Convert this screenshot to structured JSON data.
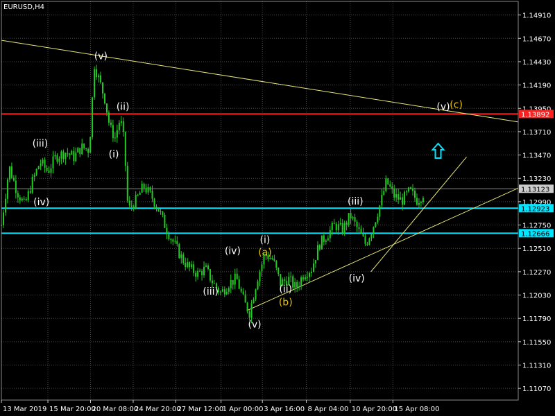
{
  "chart_data": {
    "type": "candlestick",
    "title": "EURUSD,H4",
    "colors": {
      "background": "#000000",
      "grid": "#4a4a4a",
      "candle": "#22cc22",
      "trendline": "#e8e87a",
      "resistance": "#ff2020",
      "support": "#00e5ff",
      "current_price": "#8a8a8a",
      "wave_white": "#ffffff",
      "wave_yellow": "#e8c400",
      "arrow": "#00e5ff"
    },
    "y_range": [
      1.1095,
      1.1505
    ],
    "y_ticks": [
      "1.14910",
      "1.14670",
      "1.14430",
      "1.14190",
      "1.13950",
      "1.13710",
      "1.13470",
      "1.13230",
      "1.12990",
      "1.12750",
      "1.12510",
      "1.12270",
      "1.12030",
      "1.11790",
      "1.11550",
      "1.11310",
      "1.11070"
    ],
    "x_range": [
      0,
      200
    ],
    "x_ticks": [
      {
        "label": "13 Mar 2019",
        "x": 0
      },
      {
        "label": "15 Mar 20:00",
        "x": 18
      },
      {
        "label": "20 Mar 08:00",
        "x": 34.5
      },
      {
        "label": "24 Mar 20:00",
        "x": 51
      },
      {
        "label": "27 Mar 12:00",
        "x": 67.5
      },
      {
        "label": "1 Apr 00:00",
        "x": 85
      },
      {
        "label": "3 Apr 16:00",
        "x": 101
      },
      {
        "label": "8 Apr 04:00",
        "x": 118
      },
      {
        "label": "10 Apr 20:00",
        "x": 135
      },
      {
        "label": "15 Apr 08:00",
        "x": 151.5
      }
    ],
    "horizontal_levels": [
      {
        "name": "resistance",
        "price": 1.13892,
        "label": "1.13892"
      },
      {
        "name": "current",
        "price": 1.13123,
        "label": "1.13123"
      },
      {
        "name": "support-1",
        "price": 1.12923,
        "label": "1.12923"
      },
      {
        "name": "support-2",
        "price": 1.12666,
        "label": "1.12666"
      }
    ],
    "trendlines": [
      {
        "from": [
          0,
          1.1465
        ],
        "to": [
          200,
          1.1381
        ]
      },
      {
        "from": [
          95,
          1.1187
        ],
        "to": [
          200,
          1.1313
        ]
      },
      {
        "from": [
          143,
          1.1227
        ],
        "to": [
          180,
          1.1345
        ]
      }
    ],
    "path_points": [
      [
        0,
        1.1275
      ],
      [
        3,
        1.1335
      ],
      [
        6,
        1.131
      ],
      [
        9,
        1.1295
      ],
      [
        12,
        1.132
      ],
      [
        15,
        1.134
      ],
      [
        18,
        1.133
      ],
      [
        21,
        1.1345
      ],
      [
        25,
        1.135
      ],
      [
        28,
        1.1345
      ],
      [
        31,
        1.1355
      ],
      [
        34,
        1.1352
      ],
      [
        36,
        1.144
      ],
      [
        40,
        1.1405
      ],
      [
        42,
        1.1375
      ],
      [
        44,
        1.1365
      ],
      [
        46,
        1.1385
      ],
      [
        47.5,
        1.136
      ],
      [
        49,
        1.129
      ],
      [
        52,
        1.13
      ],
      [
        55,
        1.1315
      ],
      [
        58,
        1.1305
      ],
      [
        61,
        1.129
      ],
      [
        64,
        1.127
      ],
      [
        67,
        1.1255
      ],
      [
        70,
        1.124
      ],
      [
        73,
        1.123
      ],
      [
        76,
        1.1225
      ],
      [
        79,
        1.123
      ],
      [
        82,
        1.1215
      ],
      [
        85,
        1.1205
      ],
      [
        88,
        1.1215
      ],
      [
        91,
        1.122
      ],
      [
        94,
        1.1195
      ],
      [
        96,
        1.1185
      ],
      [
        99,
        1.122
      ],
      [
        102,
        1.1245
      ],
      [
        105,
        1.124
      ],
      [
        108,
        1.1215
      ],
      [
        111,
        1.122
      ],
      [
        114,
        1.121
      ],
      [
        117,
        1.1225
      ],
      [
        120,
        1.123
      ],
      [
        123,
        1.1255
      ],
      [
        126,
        1.1265
      ],
      [
        129,
        1.1275
      ],
      [
        132,
        1.127
      ],
      [
        135,
        1.1285
      ],
      [
        138,
        1.127
      ],
      [
        141,
        1.1255
      ],
      [
        144,
        1.1275
      ],
      [
        147,
        1.13
      ],
      [
        149,
        1.132
      ],
      [
        152,
        1.1305
      ],
      [
        155,
        1.13
      ],
      [
        158,
        1.131
      ],
      [
        161,
        1.13
      ],
      [
        164,
        1.131
      ]
    ],
    "wave_labels": [
      {
        "text": "(v)",
        "x": 38.5,
        "y": 1.14455,
        "color": "white"
      },
      {
        "text": "(ii)",
        "x": 47,
        "y": 1.13935,
        "color": "white"
      },
      {
        "text": "(iii)",
        "x": 15,
        "y": 1.13555,
        "color": "white"
      },
      {
        "text": "(i)",
        "x": 43.5,
        "y": 1.13445,
        "color": "white"
      },
      {
        "text": "(iv)",
        "x": 15.5,
        "y": 1.12955,
        "color": "white"
      },
      {
        "text": "(iv)",
        "x": 89.5,
        "y": 1.1245,
        "color": "white"
      },
      {
        "text": "(i)",
        "x": 102,
        "y": 1.12565,
        "color": "white"
      },
      {
        "text": "(a)",
        "x": 102,
        "y": 1.12435,
        "color": "yellow"
      },
      {
        "text": "(iii)",
        "x": 81,
        "y": 1.12035,
        "color": "white"
      },
      {
        "text": "(ii)",
        "x": 110,
        "y": 1.1206,
        "color": "white"
      },
      {
        "text": "(b)",
        "x": 110,
        "y": 1.11925,
        "color": "yellow"
      },
      {
        "text": "(v)",
        "x": 98,
        "y": 1.11695,
        "color": "white"
      },
      {
        "text": "(iii)",
        "x": 137,
        "y": 1.1296,
        "color": "white"
      },
      {
        "text": "(iv)",
        "x": 137.5,
        "y": 1.1217,
        "color": "white"
      },
      {
        "text": "(v)",
        "x": 171,
        "y": 1.13935,
        "color": "white"
      },
      {
        "text": "(c)",
        "x": 176,
        "y": 1.13955,
        "color": "yellow"
      }
    ],
    "arrow": {
      "x": 169,
      "y": 1.1351,
      "direction": "up"
    }
  }
}
